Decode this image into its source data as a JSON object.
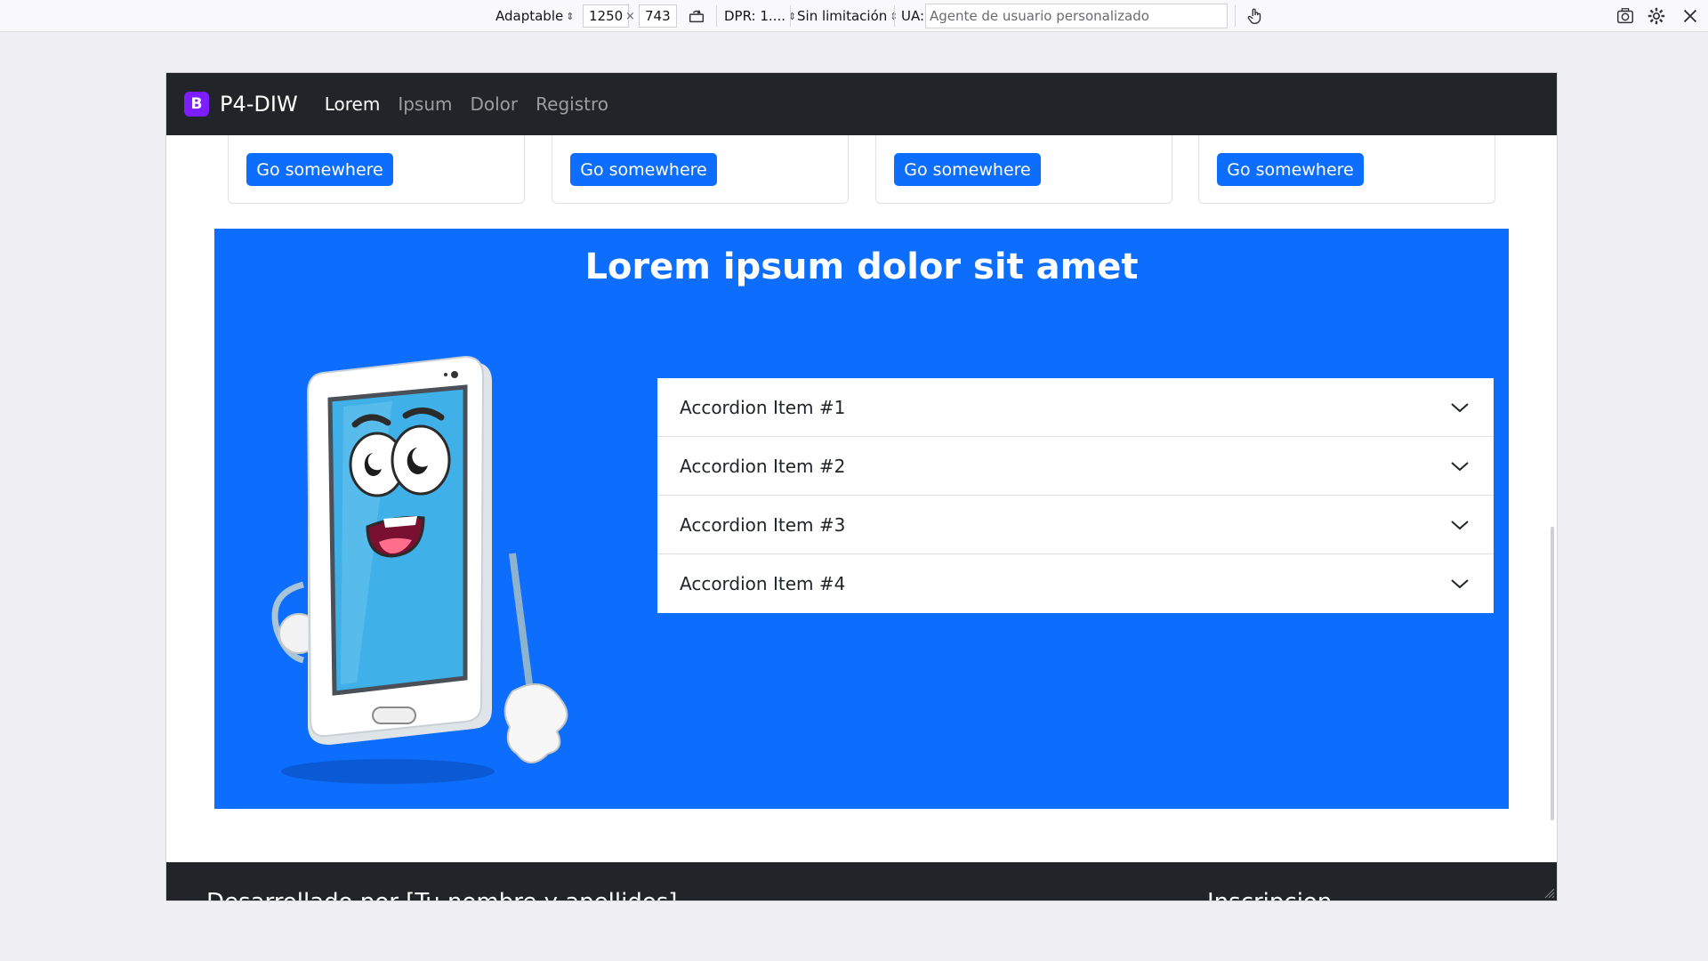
{
  "toolbar": {
    "device": "Adaptable",
    "width": "1250",
    "times": "×",
    "height": "743",
    "dpr": "DPR: 1....",
    "throttle": "Sin limitación",
    "ua_label": "UA:",
    "ua_placeholder": "Agente de usuario personalizado"
  },
  "navbar": {
    "brand_logo": "B",
    "brand": "P4-DIW",
    "links": [
      "Lorem",
      "Ipsum",
      "Dolor",
      "Registro"
    ],
    "active_index": 0
  },
  "cards": {
    "button_label": "Go somewhere"
  },
  "section": {
    "title": "Lorem ipsum dolor sit amet"
  },
  "accordion": {
    "items": [
      "Accordion Item #1",
      "Accordion Item #2",
      "Accordion Item #3",
      "Accordion Item #4"
    ]
  },
  "footer": {
    "text": "Desarrollado por [Tu nombre y apellidos]",
    "link": "Inscripcion"
  },
  "colors": {
    "primary": "#0d6efd",
    "navbar": "#212529",
    "brand": "#7c1eff"
  }
}
